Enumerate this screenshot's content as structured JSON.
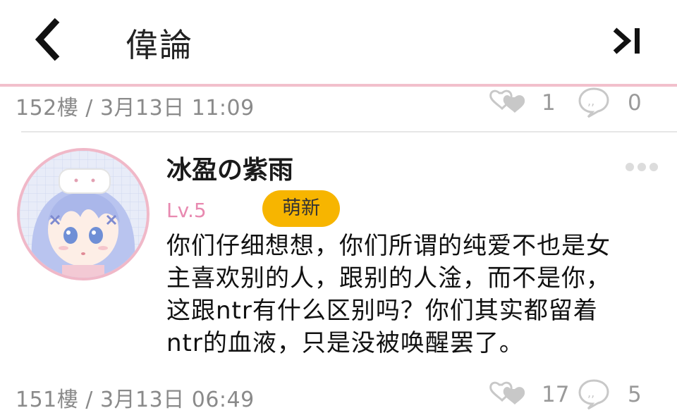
{
  "colors": {
    "accent": "#f2c0cc",
    "badge_bg": "#f7b500",
    "level": "#e889b0",
    "meta": "#8a8a8a"
  },
  "header": {
    "back_icon": "chevron-left-icon",
    "title": "偉論",
    "last_page_icon": "skip-to-end-icon"
  },
  "posts": [
    {
      "floor_time": "152樓 / 3月13日 11:09",
      "likes": "1",
      "comments": "0"
    },
    {
      "username": "冰盈の紫雨",
      "level": "Lv.5",
      "badge": "萌新",
      "avatar_icon": "anime-avatar-icon",
      "more_icon": "more-dots-icon",
      "content_lines": [
        "你们仔细想想，你们所谓的纯爱不也是女",
        "主喜欢别的人，跟别的人淦，而不是你，",
        "这跟ntr有什么区别吗？你们其实都留着",
        "ntr的血液，只是没被唤醒罢了。"
      ]
    },
    {
      "floor_time": "151樓 / 3月13日 06:49",
      "likes": "17",
      "comments": "5"
    }
  ]
}
